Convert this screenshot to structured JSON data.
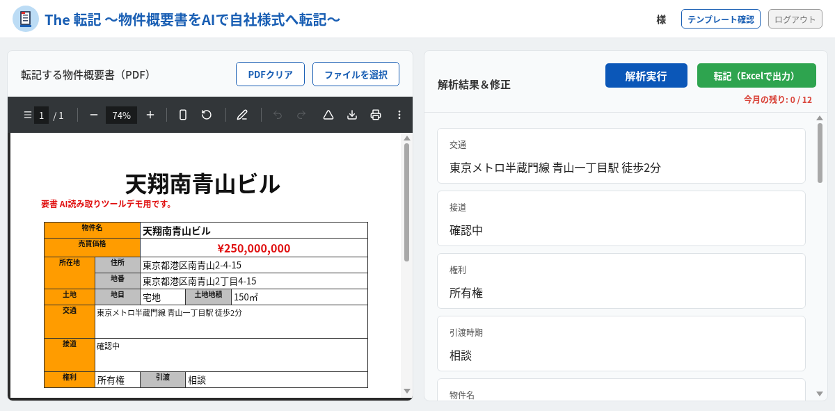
{
  "header": {
    "title": "The 転記 〜物件概要書をAIで自社様式へ転記〜",
    "user_suffix": "様",
    "buttons": [
      {
        "label": "テンプレート確認",
        "kind": "outline"
      },
      {
        "label": "ログアウト",
        "kind": "muted"
      }
    ]
  },
  "pdf_panel": {
    "title": "転記する物件概要書（PDF）",
    "buttons": [
      {
        "label": "PDFクリア",
        "kind": "outline"
      },
      {
        "label": "ファイルを選択",
        "kind": "outline"
      }
    ],
    "viewer": {
      "page_current": "1",
      "page_total": "/ 1",
      "zoom": "74%",
      "tools": [
        {
          "kind": "fit",
          "disabled": false
        },
        {
          "kind": "rotate",
          "disabled": false
        },
        {
          "kind": "sep"
        },
        {
          "kind": "sign",
          "disabled": false
        },
        {
          "kind": "sep"
        },
        {
          "kind": "undo",
          "disabled": true
        },
        {
          "kind": "redo",
          "disabled": true
        },
        {
          "kind": "gap"
        },
        {
          "kind": "drive",
          "disabled": false
        },
        {
          "kind": "download",
          "disabled": false
        },
        {
          "kind": "print",
          "disabled": false
        },
        {
          "kind": "more",
          "disabled": false
        }
      ],
      "document": {
        "title": "天翔南青山ビル",
        "notice": "要書 AI読み取りツールデモ用です。",
        "rows": [
          {
            "kind": "normal",
            "cells": [
              {
                "text": "物件名",
                "kind": "head",
                "colspan": 2
              },
              {
                "text": "天翔南青山ビル",
                "kind": "strong",
                "colspan": 3
              }
            ]
          },
          {
            "kind": "normal",
            "cells": [
              {
                "text": "売買価格",
                "kind": "head",
                "colspan": 2
              },
              {
                "text": "¥250,000,000",
                "kind": "price",
                "colspan": 3
              }
            ]
          },
          {
            "kind": "normal",
            "cells": [
              {
                "text": "所在地",
                "kind": "head",
                "rowspan": 2
              },
              {
                "text": "住所",
                "kind": "sub"
              },
              {
                "text": "東京都港区南青山2-4-15",
                "kind": "value",
                "colspan": 3
              }
            ]
          },
          {
            "kind": "normal",
            "cells": [
              {
                "text": "地番",
                "kind": "sub"
              },
              {
                "text": "東京都港区南青山2丁目4-15",
                "kind": "value",
                "colspan": 3
              }
            ]
          },
          {
            "kind": "normal",
            "cells": [
              {
                "text": "土地",
                "kind": "head"
              },
              {
                "text": "地目",
                "kind": "sub"
              },
              {
                "text": "宅地",
                "kind": "value"
              },
              {
                "text": "土地地積",
                "kind": "sub"
              },
              {
                "text": "150㎡",
                "kind": "value"
              }
            ]
          },
          {
            "kind": "tall",
            "cells": [
              {
                "text": "交通",
                "kind": "head"
              },
              {
                "text": "東京メトロ半蔵門線 青山一丁目駅 徒歩2分",
                "kind": "small",
                "colspan": 4
              }
            ]
          },
          {
            "kind": "tall",
            "cells": [
              {
                "text": "接道",
                "kind": "head"
              },
              {
                "text": "確認中",
                "kind": "small",
                "colspan": 4
              }
            ]
          },
          {
            "kind": "normal",
            "cells": [
              {
                "text": "権利",
                "kind": "head"
              },
              {
                "text": "所有権",
                "kind": "value"
              },
              {
                "text": "引渡",
                "kind": "sub"
              },
              {
                "text": "相談",
                "kind": "value",
                "colspan": 2
              }
            ]
          }
        ]
      }
    }
  },
  "result_panel": {
    "title": "解析結果＆修正",
    "buttons": [
      {
        "label": "解析実行",
        "kind": "primary"
      },
      {
        "label": "転記（Excelで出力）",
        "kind": "success"
      }
    ],
    "remaining": "今月の残り: 0 / 12",
    "fields": [
      {
        "label": "交通",
        "value": "東京メトロ半蔵門線 青山一丁目駅 徒歩2分"
      },
      {
        "label": "接道",
        "value": "確認中"
      },
      {
        "label": "権利",
        "value": "所有権"
      },
      {
        "label": "引渡時期",
        "value": "相談"
      },
      {
        "label": "物件名"
      }
    ]
  }
}
